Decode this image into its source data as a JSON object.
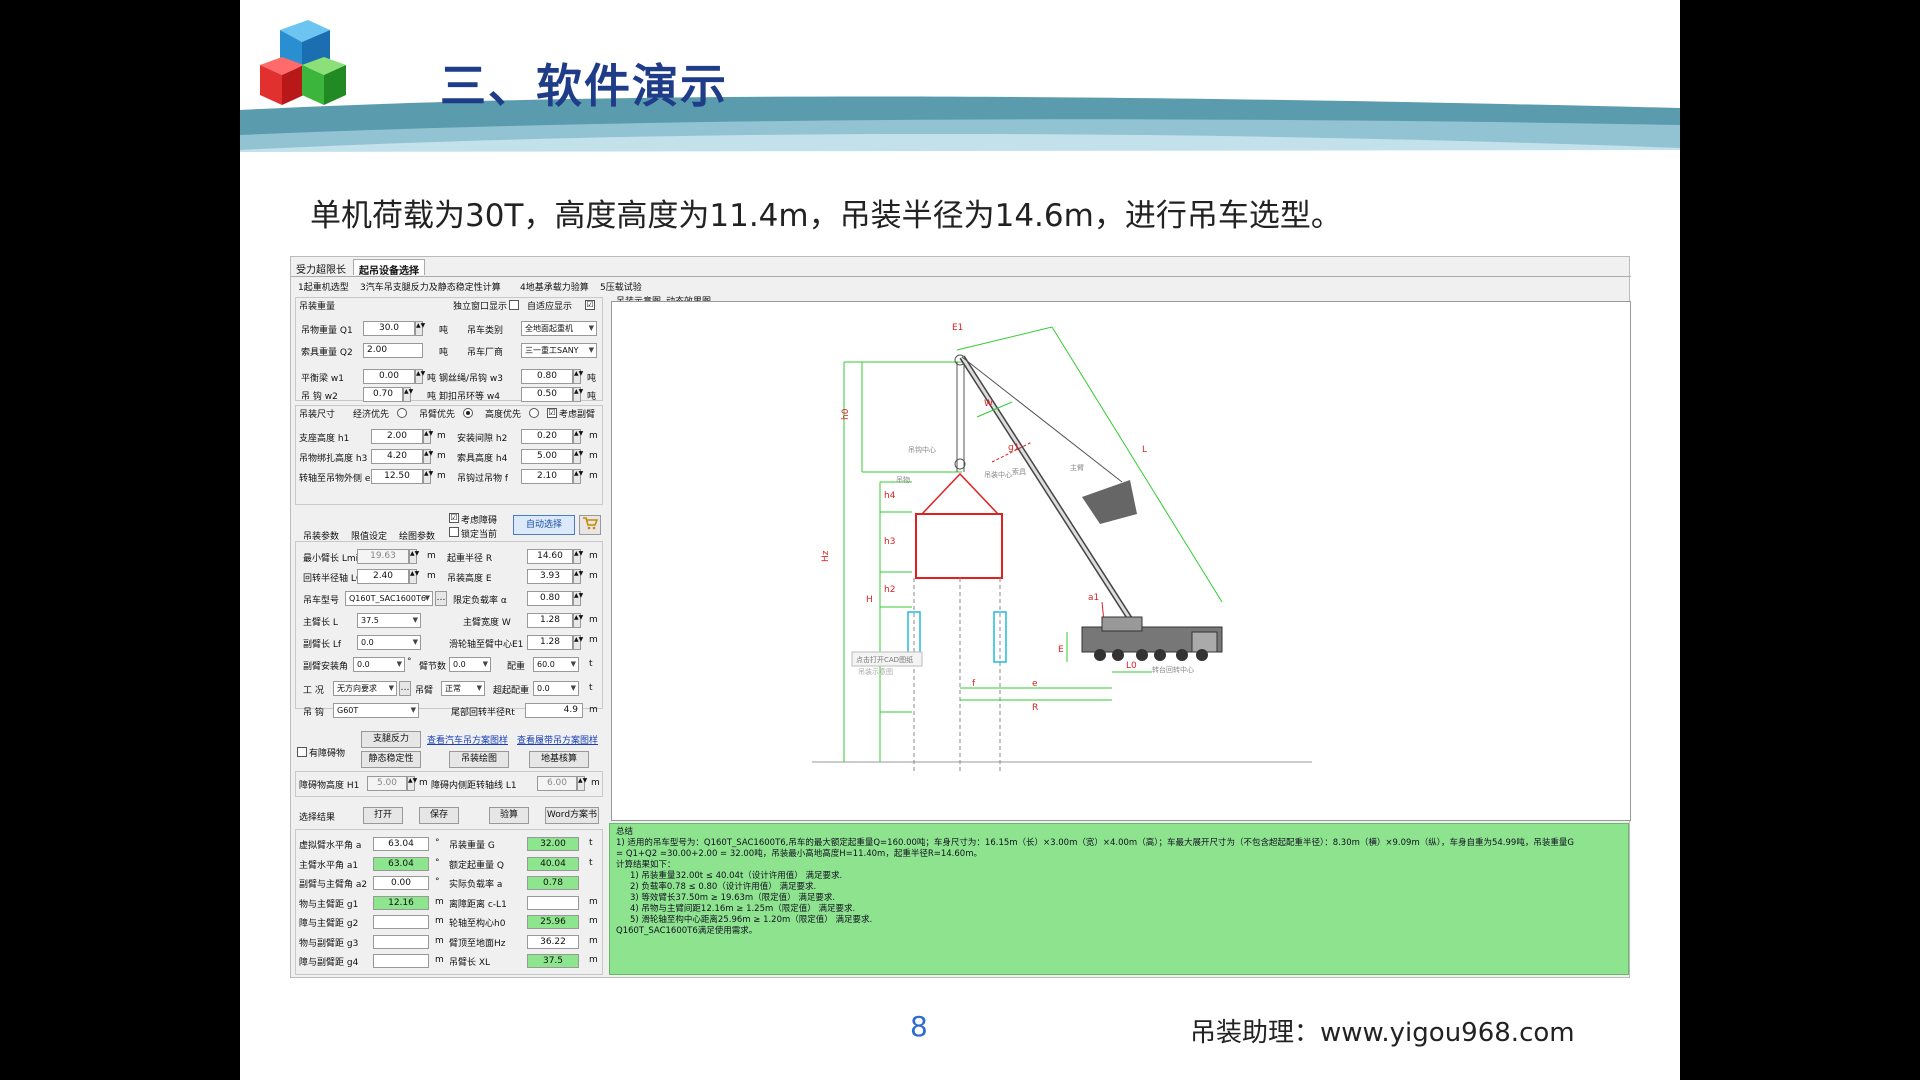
{
  "slide": {
    "title": "三、软件演示",
    "subtitle": "单机荷载为30T，高度高度为11.4m，吊装半径为14.6m，进行吊车选型。",
    "page_number": "8",
    "footer": "吊装助理：www.yigou968.com",
    "colors": {
      "title": "#1f3c88",
      "band": "#3d8aa0",
      "page_number": "#2e6bd1"
    }
  },
  "app": {
    "top_tabs": [
      "受力超限长",
      "起吊设备选择"
    ],
    "sub_tabs": [
      "1起重机选型",
      "3汽车吊支腿反力及静态稳定性计算",
      "4地基承载力验算",
      "5压载试验"
    ],
    "view_tabs": [
      "吊装示意图",
      "动态效果图"
    ],
    "lift_weight": {
      "group_label": "吊装重量",
      "window_display_label": "独立窗口显示",
      "auto_adapt_label": "自适应显示",
      "auto_adapt_check": "☑",
      "q1_label": "吊物重量 Q1",
      "q1_value": "30.0",
      "q1_unit": "吨",
      "crane_type_label": "吊车类别",
      "crane_type_value": "全地面起重机",
      "q2_label": "索具重量 Q2",
      "q2_value": "2.00",
      "q2_unit": "吨",
      "maker_label": "吊车厂商",
      "maker_value": "三一重工SANY",
      "w1_label": "平衡梁 w1",
      "w1_value": "0.00",
      "w1_unit": "吨",
      "w3_label": "钢丝绳/吊钩 w3",
      "w3_value": "0.80",
      "w3_unit": "吨",
      "w2_label": "吊 钩 w2",
      "w2_value": "0.70",
      "w2_unit": "吨",
      "w4_label": "卸扣吊环等 w4",
      "w4_value": "0.50",
      "w4_unit": "吨"
    },
    "lift_size": {
      "group_label": "吊装尺寸",
      "opt_economy": "经济优先",
      "opt_arm": "吊臂优先",
      "opt_height": "高度优先",
      "consider_jib_label": "考虑副臂",
      "consider_jib_check": "☑",
      "h1_label": "支座高度 h1",
      "h1_value": "2.00",
      "h1_unit": "m",
      "h2_label": "安装间隙 h2",
      "h2_value": "0.20",
      "h2_unit": "m",
      "h3_label": "吊物绑扎高度 h3",
      "h3_value": "4.20",
      "h3_unit": "m",
      "h4_label": "索具高度 h4",
      "h4_value": "5.00",
      "h4_unit": "m",
      "e_label": "转轴至吊物外侧 e",
      "e_value": "12.50",
      "e_unit": "m",
      "f_label": "吊钩过吊物 f",
      "f_value": "2.10",
      "f_unit": "m"
    },
    "param_tabs": [
      "吊装参数",
      "限值设定",
      "绘图参数"
    ],
    "consider_obstacle_label": "考虑障碍",
    "consider_obstacle_check": "☑",
    "lock_label": "锁定当前",
    "auto_select_button": "自动选择",
    "cart_icon": "cart-icon",
    "params": {
      "lmin_label": "最小臂长 Lmin",
      "lmin_value": "19.63",
      "lmin_unit": "m",
      "r_label": "起重半径 R",
      "r_value": "14.60",
      "r_unit": "m",
      "l0_label": "回转半径轴 L0",
      "l0_value": "2.40",
      "l0_unit": "m",
      "e2_label": "吊装高度 E",
      "e2_value": "3.93",
      "e2_unit": "m",
      "model_label": "吊车型号",
      "model_value": "Q160T_SAC1600T6",
      "rate_label": "限定负载率 α",
      "rate_value": "0.80",
      "l_label": "主臂长 L",
      "l_value": "37.5",
      "w_label": "主臂宽度 W",
      "w_value": "1.28",
      "w_unit": "m",
      "lf_label": "副臂长 Lf",
      "lf_value": "0.0",
      "e1_label": "滑轮轴至臂中心E1",
      "e1_value": "1.28",
      "e1_unit": "m",
      "jib_angle_label": "副臂安装角",
      "jib_angle_value": "0.0",
      "jib_angle_unit": "°",
      "sections_label": "臂节数",
      "sections_value": "0.0",
      "counterweight_label": "配重",
      "counterweight_value": "60.0",
      "counterweight_unit": "t",
      "condition_label": "工 况",
      "condition_value": "无方向要求",
      "arm_label": "吊臂",
      "arm_value": "正常",
      "extra_cw_label": "超起配重",
      "extra_cw_value": "0.0",
      "extra_cw_unit": "t",
      "hook_label": "吊 钩",
      "hook_value": "G60T",
      "tail_label": "尾部回转半径Rt",
      "tail_value": "4.9",
      "tail_unit": "m"
    },
    "obstacle_label": "有障碍物",
    "btn_outrigger": "支腿反力",
    "btn_stability": "静态稳定性",
    "btn_draw": "吊装绘图",
    "btn_ground": "地基核算",
    "link_car": "查看汽车吊方案图样",
    "link_crawler": "查看履带吊方案图样",
    "obstacle": {
      "h1_label": "障碍物高度 H1",
      "h1_value": "5.00",
      "h1_unit": "m",
      "l1_label": "障碍内侧距转轴线 L1",
      "l1_value": "6.00",
      "l1_unit": "m"
    },
    "results_label": "选择结果",
    "btn_open": "打开",
    "btn_save": "保存",
    "btn_check": "验算",
    "btn_word": "Word方案书",
    "results": [
      {
        "l": "虚拟臂水平角 a",
        "v": "63.04",
        "u": "°",
        "rl": "吊装重量 G",
        "rv": "32.00",
        "ru": "t",
        "vg": false,
        "rg": true
      },
      {
        "l": "主臂水平角 a1",
        "v": "63.04",
        "u": "°",
        "rl": "额定起重量 Q",
        "rv": "40.04",
        "ru": "t",
        "vg": true,
        "rg": true
      },
      {
        "l": "副臂与主臂角 a2",
        "v": "0.00",
        "u": "°",
        "rl": "实际负载率 a",
        "rv": "0.78",
        "ru": "",
        "vg": false,
        "rg": true
      },
      {
        "l": "物与主臂距 g1",
        "v": "12.16",
        "u": "m",
        "rl": "离障距离 c-L1",
        "rv": "",
        "ru": "m",
        "vg": true,
        "rg": false
      },
      {
        "l": "障与主臂距 g2",
        "v": "",
        "u": "m",
        "rl": "轮轴至构心h0",
        "rv": "25.96",
        "ru": "m",
        "vg": false,
        "rg": true
      },
      {
        "l": "物与副臂距 g3",
        "v": "",
        "u": "m",
        "rl": "臂顶至地面Hz",
        "rv": "36.22",
        "ru": "m",
        "vg": false,
        "rg": false
      },
      {
        "l": "障与副臂距 g4",
        "v": "",
        "u": "m",
        "rl": "吊臂长 XL",
        "rv": "37.5",
        "ru": "m",
        "vg": false,
        "rg": true
      }
    ],
    "summary": [
      "总结",
      "1) 适用的吊车型号为：Q160T_SAC1600T6,吊车的最大额定起重量Q=160.00吨；车身尺寸为：16.15m（长）×3.00m（宽）×4.00m（高）；车最大展开尺寸为（不包含超起配重半径）：8.30m（横）×9.09m（纵），车身自重为54.99吨，吊装重量G",
      "= Q1+Q2 =30.00+2.00 = 32.00吨，吊装最小高地高度H=11.40m，起重半径R=14.60m。",
      "计算结果如下：",
      "1) 吊装重量32.00t ≤ 40.04t（设计许用值） 满足要求.",
      "2) 负载率0.78 ≤ 0.80（设计许用值） 满足要求.",
      "3) 等效臂长37.50m ≥ 19.63m（限定值） 满足要求.",
      "4) 吊物与主臂间距12.16m ≥ 1.25m（限定值） 满足要求.",
      "5) 滑轮轴至构中心距离25.96m ≥ 1.20m（限定值） 满足要求.",
      "Q160T_SAC1600T6满足使用需求。"
    ],
    "drawing": {
      "labels": [
        "E1",
        "h0",
        "W",
        "g1",
        "L",
        "Hz",
        "h4",
        "h3",
        "H",
        "h2",
        "h1",
        "a1",
        "E",
        "L0",
        "f",
        "e",
        "R",
        "吊钩中心",
        "吊装中心",
        "主臂",
        "吊物",
        "索具",
        "转台回转中心",
        "点击打开CAD图纸",
        "吊装示意图"
      ],
      "colors": {
        "boom": "#444444",
        "dim_green": "#33cc33",
        "load_red": "#dd2222",
        "support_cyan": "#22bbdd"
      }
    }
  }
}
